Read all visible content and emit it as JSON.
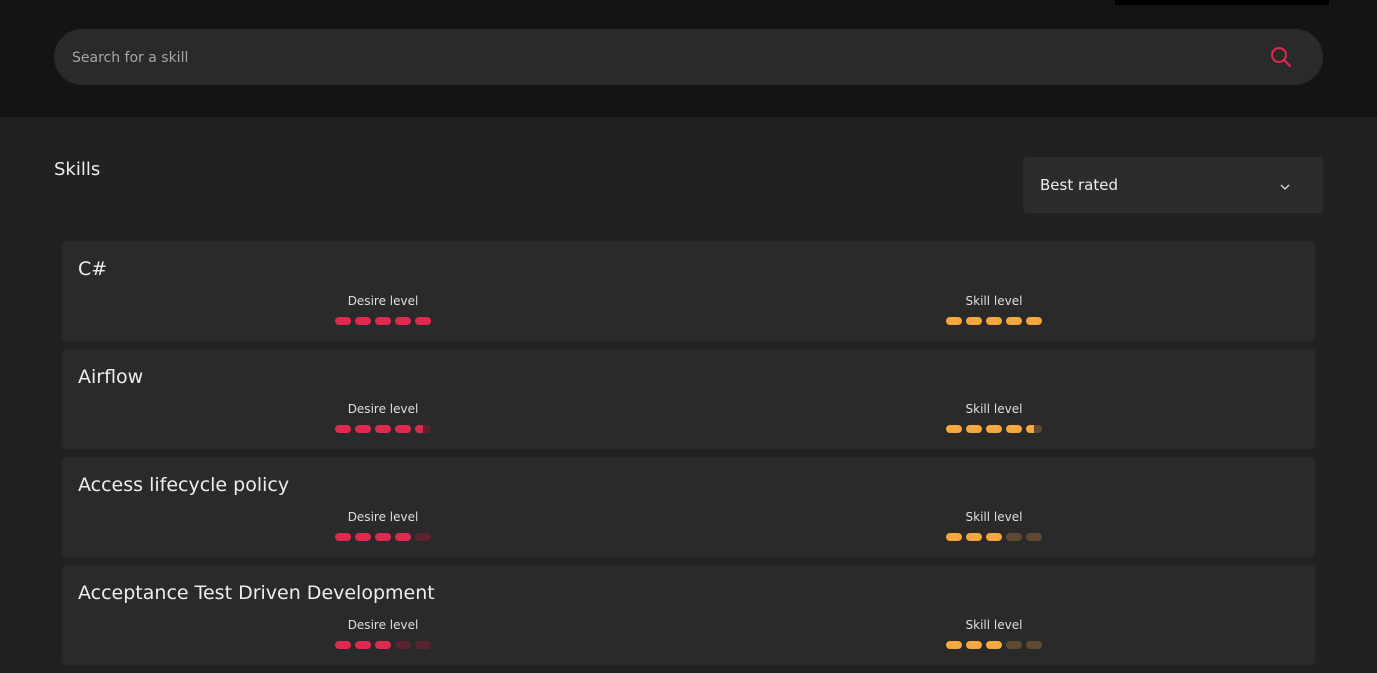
{
  "search": {
    "placeholder": "Search for a skill",
    "value": "",
    "icon": "search-icon"
  },
  "section": {
    "title": "Skills"
  },
  "sort": {
    "selected": "Best rated",
    "icon": "chevron-down-icon"
  },
  "colors": {
    "desire_on": "#e0294f",
    "desire_off": "#5a2431",
    "skill_on": "#f5a83b",
    "skill_off": "#5e4a33",
    "accent": "#e0294f"
  },
  "skills": [
    {
      "name": "C#",
      "desire_label": "Desire level",
      "desire_level": 5,
      "skill_label": "Skill level",
      "skill_level": 5
    },
    {
      "name": "Airflow",
      "desire_label": "Desire level",
      "desire_level": 4.5,
      "skill_label": "Skill level",
      "skill_level": 4.5
    },
    {
      "name": "Access lifecycle policy",
      "desire_label": "Desire level",
      "desire_level": 4,
      "skill_label": "Skill level",
      "skill_level": 3
    },
    {
      "name": "Acceptance Test Driven Development",
      "desire_label": "Desire level",
      "desire_level": 3,
      "skill_label": "Skill level",
      "skill_level": 3
    }
  ]
}
